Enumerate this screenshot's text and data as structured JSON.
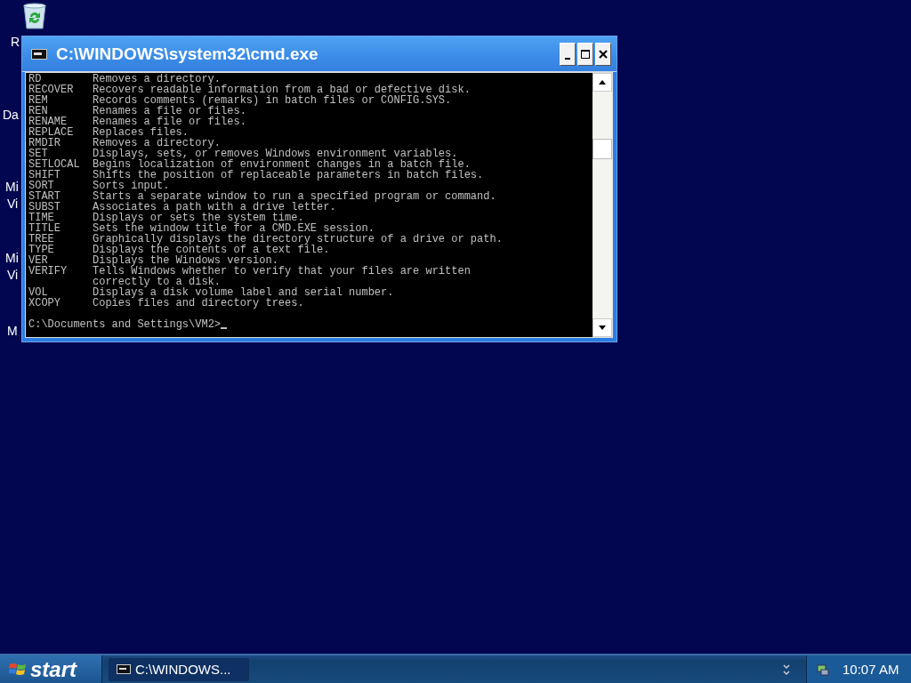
{
  "desktop_labels": [
    {
      "text": "R"
    },
    {
      "text": "Da"
    },
    {
      "text": "Mi"
    },
    {
      "text": "Vi"
    },
    {
      "text": "Mi"
    },
    {
      "text": "Vi"
    },
    {
      "text": "M"
    }
  ],
  "window": {
    "title": "C:\\WINDOWS\\system32\\cmd.exe",
    "console_lines": [
      {
        "command": "RD",
        "description": "Removes a directory."
      },
      {
        "command": "RECOVER",
        "description": "Recovers readable information from a bad or defective disk."
      },
      {
        "command": "REM",
        "description": "Records comments (remarks) in batch files or CONFIG.SYS."
      },
      {
        "command": "REN",
        "description": "Renames a file or files."
      },
      {
        "command": "RENAME",
        "description": "Renames a file or files."
      },
      {
        "command": "REPLACE",
        "description": "Replaces files."
      },
      {
        "command": "RMDIR",
        "description": "Removes a directory."
      },
      {
        "command": "SET",
        "description": "Displays, sets, or removes Windows environment variables."
      },
      {
        "command": "SETLOCAL",
        "description": "Begins localization of environment changes in a batch file."
      },
      {
        "command": "SHIFT",
        "description": "Shifts the position of replaceable parameters in batch files."
      },
      {
        "command": "SORT",
        "description": "Sorts input."
      },
      {
        "command": "START",
        "description": "Starts a separate window to run a specified program or command."
      },
      {
        "command": "SUBST",
        "description": "Associates a path with a drive letter."
      },
      {
        "command": "TIME",
        "description": "Displays or sets the system time."
      },
      {
        "command": "TITLE",
        "description": "Sets the window title for a CMD.EXE session."
      },
      {
        "command": "TREE",
        "description": "Graphically displays the directory structure of a drive or path."
      },
      {
        "command": "TYPE",
        "description": "Displays the contents of a text file."
      },
      {
        "command": "VER",
        "description": "Displays the Windows version."
      },
      {
        "command": "VERIFY",
        "description": "Tells Windows whether to verify that your files are written"
      },
      {
        "description": "correctly to a disk."
      },
      {
        "command": "VOL",
        "description": "Displays a disk volume label and serial number."
      },
      {
        "command": "XCOPY",
        "description": "Copies files and directory trees."
      }
    ],
    "prompt": "C:\\Documents and Settings\\VM2>"
  },
  "taskbar": {
    "start": "start",
    "tasks": [
      {
        "label": "C:\\WINDOWS...",
        "selected": true
      }
    ],
    "clock": "10:07 AM"
  }
}
